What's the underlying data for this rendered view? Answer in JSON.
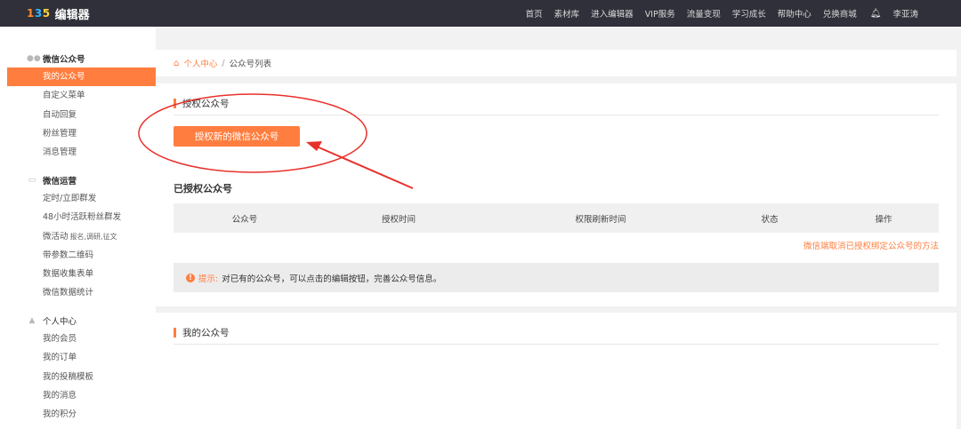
{
  "logo": {
    "mark": [
      "1",
      "3",
      "5"
    ],
    "text": "编辑器"
  },
  "topnav": {
    "items": [
      "首页",
      "素材库",
      "进入编辑器",
      "VIP服务",
      "流量变现",
      "学习成长",
      "帮助中心",
      "兑换商城"
    ],
    "user": "李亚涛",
    "bell_icon": "bell-icon"
  },
  "sidebar": {
    "groups": [
      {
        "title": "微信公众号",
        "icon": "chat-icon",
        "items": [
          "我的公众号",
          "自定义菜单",
          "自动回复",
          "粉丝管理",
          "消息管理"
        ],
        "active": 0
      },
      {
        "title": "微信运营",
        "icon": "keyboard-icon",
        "items": [
          "定时/立即群发",
          "48小时活跃粉丝群发",
          "微活动",
          "带参数二维码",
          "数据收集表单",
          "微信数据统计"
        ],
        "extra": {
          "index": 2,
          "text": "报名,调研,征文"
        }
      },
      {
        "title": "个人中心",
        "icon": "user-icon",
        "items": [
          "我的会员",
          "我的订单",
          "我的投稿模板",
          "我的消息",
          "我的积分"
        ]
      }
    ]
  },
  "breadcrumb": {
    "home": "个人中心",
    "sep": "/",
    "current": "公众号列表",
    "home_icon": "home-icon"
  },
  "auth_section": {
    "title": "授权公众号",
    "button": "授权新的微信公众号",
    "list_title": "已授权公众号",
    "columns": [
      "公众号",
      "授权时间",
      "权限刷新时间",
      "状态",
      "操作"
    ],
    "help_link": "微信端取消已授权绑定公众号的方法",
    "tip_label": "提示:",
    "tip_text": "对已有的公众号，可以点击的编辑按钮，完善公众号信息。"
  },
  "my_section": {
    "title": "我的公众号"
  },
  "colors": {
    "accent": "#ff7e3f",
    "topbar": "#2f3039",
    "annotation": "#e8312b"
  }
}
